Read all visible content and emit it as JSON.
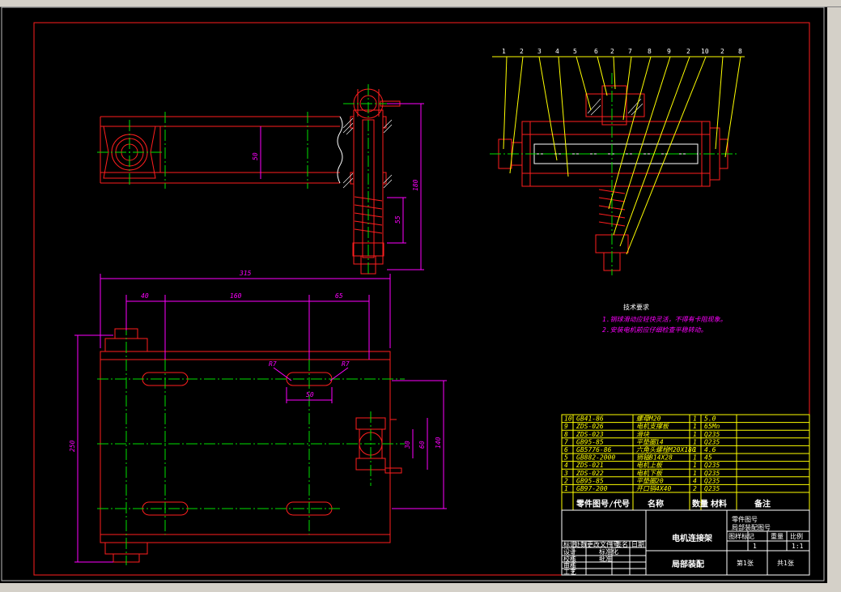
{
  "drawing": {
    "dimensions": {
      "d50": "50",
      "d180": "180",
      "d55": "55",
      "d315": "315",
      "d40": "40",
      "d160": "160",
      "d65": "65",
      "d250": "250",
      "r7a": "R7",
      "r7b": "R7",
      "d50b": "50",
      "d30": "30",
      "d60": "60",
      "d140": "140"
    },
    "balloons": [
      "1",
      "2",
      "3",
      "4",
      "5",
      "6",
      "2",
      "7",
      "8",
      "9",
      "2",
      "10",
      "2",
      "8"
    ],
    "tech_requirements": {
      "title": "技术要求",
      "lines": [
        "1.钢球滑动应轻快灵活，不得有卡阻现象。",
        "2.安装电机前应仔细检查平稳转动。"
      ]
    }
  },
  "bom": {
    "rows": [
      {
        "no": "10",
        "code": "GB41-86",
        "name": "螺母M20",
        "qty": "1",
        "material": "5.0",
        "note": ""
      },
      {
        "no": "9",
        "code": "ZDS-026",
        "name": "电机支撑板",
        "qty": "1",
        "material": "65Mn",
        "note": ""
      },
      {
        "no": "8",
        "code": "ZDS-023",
        "name": "滑块",
        "qty": "1",
        "material": "Q235",
        "note": ""
      },
      {
        "no": "7",
        "code": "GB95-85",
        "name": "平垫圈14",
        "qty": "1",
        "material": "Q235",
        "note": ""
      },
      {
        "no": "6",
        "code": "GB5776-86",
        "name": "六角头螺栓M20X180",
        "qty": "1",
        "material": "4.6",
        "note": ""
      },
      {
        "no": "5",
        "code": "GB882-2000",
        "name": "销轴B14X28",
        "qty": "1",
        "material": "45",
        "note": ""
      },
      {
        "no": "4",
        "code": "ZDS-021",
        "name": "电机上板",
        "qty": "1",
        "material": "Q235",
        "note": ""
      },
      {
        "no": "3",
        "code": "ZDS-022",
        "name": "电机下板",
        "qty": "1",
        "material": "Q235",
        "note": ""
      },
      {
        "no": "2",
        "code": "GB95-85",
        "name": "平垫圈20",
        "qty": "4",
        "material": "Q235",
        "note": ""
      },
      {
        "no": "1",
        "code": "GB97-200",
        "name": "开口销4X40",
        "qty": "2",
        "material": "Q235",
        "note": ""
      }
    ],
    "header": {
      "code": "零件图号/代号",
      "name": "名称",
      "qty": "数量",
      "material": "材料",
      "note": "备注"
    }
  },
  "title_block": {
    "assembly_name": "电机连接架",
    "sub_name": "局部装配",
    "drawing_no_label": "图样标记",
    "weight_label": "重量",
    "scale_label": "比例",
    "scale_value": "1:1",
    "sheet_label": "第1张",
    "sheets_total": "共1张",
    "left_labels": [
      "标记",
      "处数",
      "更改文件号",
      "签名",
      "日期"
    ],
    "roles": [
      "设计",
      "校核",
      "审核",
      "工艺"
    ],
    "std_label": "标准化",
    "approve_label": "批准",
    "code_label": "零件图号",
    "unit_label": "局部装配图号",
    "qty_value": "1"
  },
  "colors": {
    "background": "#000000",
    "outline": "#ff1e1e",
    "centerline": "#00e000",
    "dimension": "#ff00ff",
    "table": "#ffff00",
    "text": "#ffffff"
  }
}
